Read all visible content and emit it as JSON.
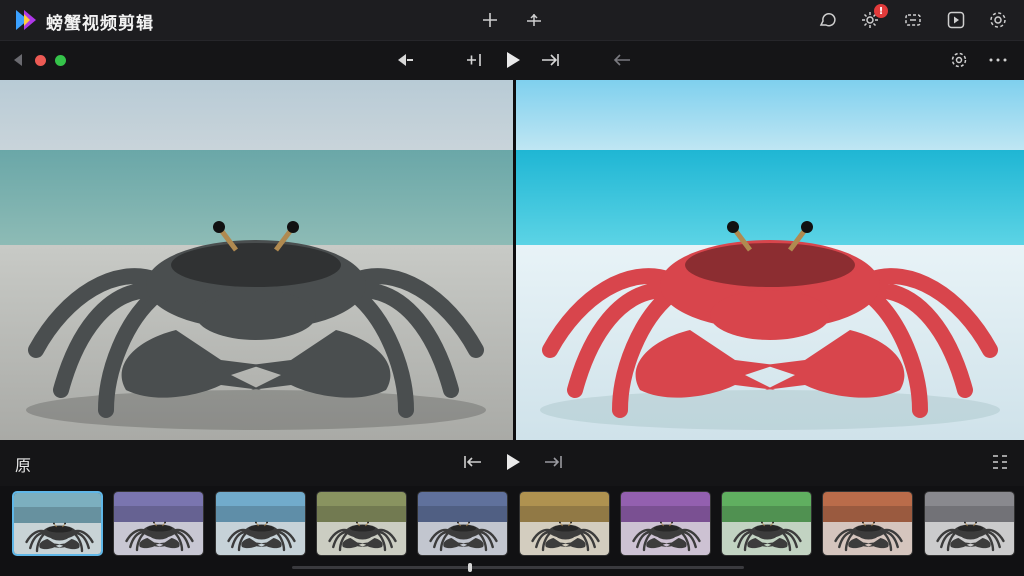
{
  "app": {
    "title": "螃蟹视频剪辑",
    "accent_color": "#5fb7e8",
    "notification_count": "!"
  },
  "titlebar": {
    "icons": [
      "add-icon",
      "split-icon",
      "chat-icon",
      "settings-icon",
      "screen-record-icon",
      "play-window-icon",
      "gear-icon"
    ]
  },
  "toolbar": {
    "icons": [
      "back-icon",
      "prev-frame-icon",
      "insert-icon",
      "play-icon",
      "next-frame-icon",
      "undo-icon",
      "settings-icon",
      "more-icon"
    ]
  },
  "preview": {
    "left": {
      "image": "crab-original-photo"
    },
    "right": {
      "image": "crab-filtered-photo"
    }
  },
  "playback": {
    "original_label": "原",
    "icons": [
      "rewind-icon",
      "play-icon",
      "forward-icon",
      "list-icon"
    ]
  },
  "filters": {
    "items": [
      {
        "name": "filter-1",
        "tint": "#8cc6d8",
        "active": true
      },
      {
        "name": "filter-2",
        "tint": "#8a84c6",
        "active": false
      },
      {
        "name": "filter-3",
        "tint": "#7fc2e6",
        "active": false
      },
      {
        "name": "filter-4",
        "tint": "#9aa66c",
        "active": false
      },
      {
        "name": "filter-5",
        "tint": "#6c7fb0",
        "active": false
      },
      {
        "name": "filter-6",
        "tint": "#c6a45a",
        "active": false
      },
      {
        "name": "filter-7",
        "tint": "#a66cc6",
        "active": false
      },
      {
        "name": "filter-8",
        "tint": "#6cc66c",
        "active": false
      },
      {
        "name": "filter-9",
        "tint": "#d27a52",
        "active": false
      },
      {
        "name": "filter-10",
        "tint": "#9a9aa0",
        "active": false
      }
    ]
  },
  "scrollbar": {
    "position": 0.39
  }
}
